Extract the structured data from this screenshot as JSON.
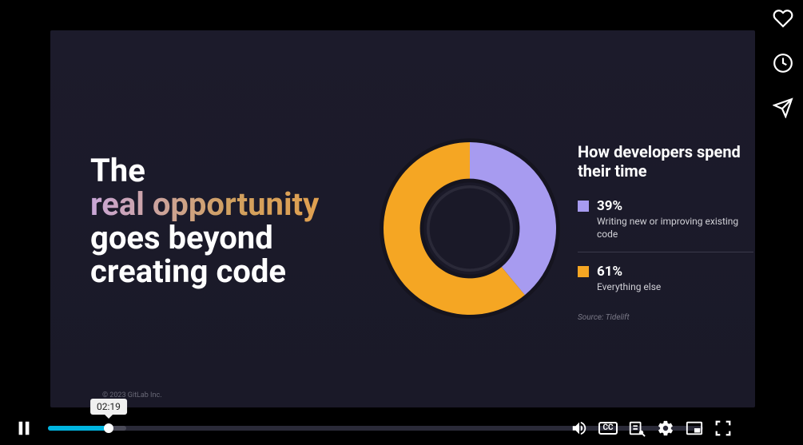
{
  "slide": {
    "headline_line1": "The",
    "headline_grad": "real opportunity",
    "headline_line3": "goes beyond",
    "headline_line4": "creating code",
    "footer": "© 2023 GitLab Inc.",
    "legend_title": "How developers spend their time",
    "legend_source": "Source: Tidelift"
  },
  "chart_data": {
    "type": "pie",
    "title": "How developers spend their time",
    "series": [
      {
        "name": "Writing new or improving existing code",
        "value": 39,
        "color": "#a79bf0",
        "pct_label": "39%"
      },
      {
        "name": "Everything else",
        "value": 61,
        "color": "#f5a623",
        "pct_label": "61%"
      }
    ],
    "source": "Tidelift"
  },
  "player": {
    "current_seconds": 139,
    "duration_seconds": 1500,
    "buffered_seconds": 180,
    "tooltip_time": "02:19",
    "cc_label": "CC"
  },
  "actions": {
    "like": "like",
    "watch_later": "watch-later",
    "share": "share"
  }
}
